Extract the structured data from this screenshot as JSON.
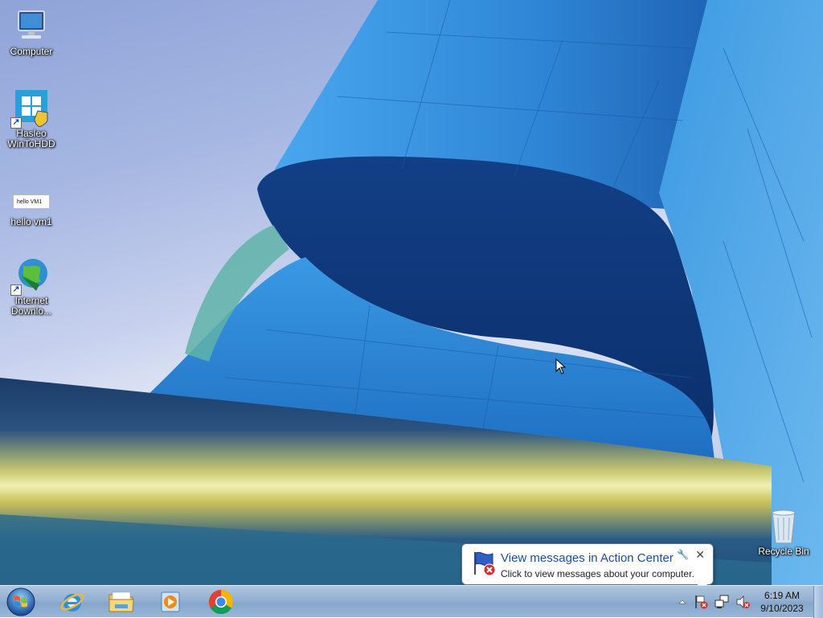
{
  "desktop": {
    "icons": [
      {
        "name": "computer",
        "label": "Computer"
      },
      {
        "name": "hasleo-wintohdd",
        "label": "Hasleo\nWinToHDD"
      },
      {
        "name": "hello-vm1",
        "label": "hello vm1",
        "thumbnail_text": "hello VM1"
      },
      {
        "name": "internet-download-manager",
        "label": "Internet\nDownlo..."
      },
      {
        "name": "recycle-bin",
        "label": "Recycle Bin"
      }
    ]
  },
  "taskbar": {
    "pinned": [
      {
        "name": "start",
        "icon": "windows-orb-icon"
      },
      {
        "name": "internet-explorer",
        "icon": "internet-explorer-icon"
      },
      {
        "name": "windows-explorer",
        "icon": "folder-icon"
      },
      {
        "name": "media-player",
        "icon": "media-player-icon"
      },
      {
        "name": "chrome",
        "icon": "chrome-icon"
      }
    ],
    "tray": {
      "icons": [
        "show-hidden-icons-arrow",
        "action-center-flag-icon",
        "network-icon",
        "volume-muted-icon"
      ]
    },
    "clock": {
      "time": "6:19 AM",
      "date": "9/10/2023"
    }
  },
  "balloon": {
    "title": "View messages in Action Center",
    "text": "Click to view messages about your computer.",
    "close": "✕",
    "options": "🔧"
  },
  "colors": {
    "taskbar": "#94b1d2",
    "balloon_title": "#1e4c9a",
    "building_blue": "#3a8fd8"
  }
}
